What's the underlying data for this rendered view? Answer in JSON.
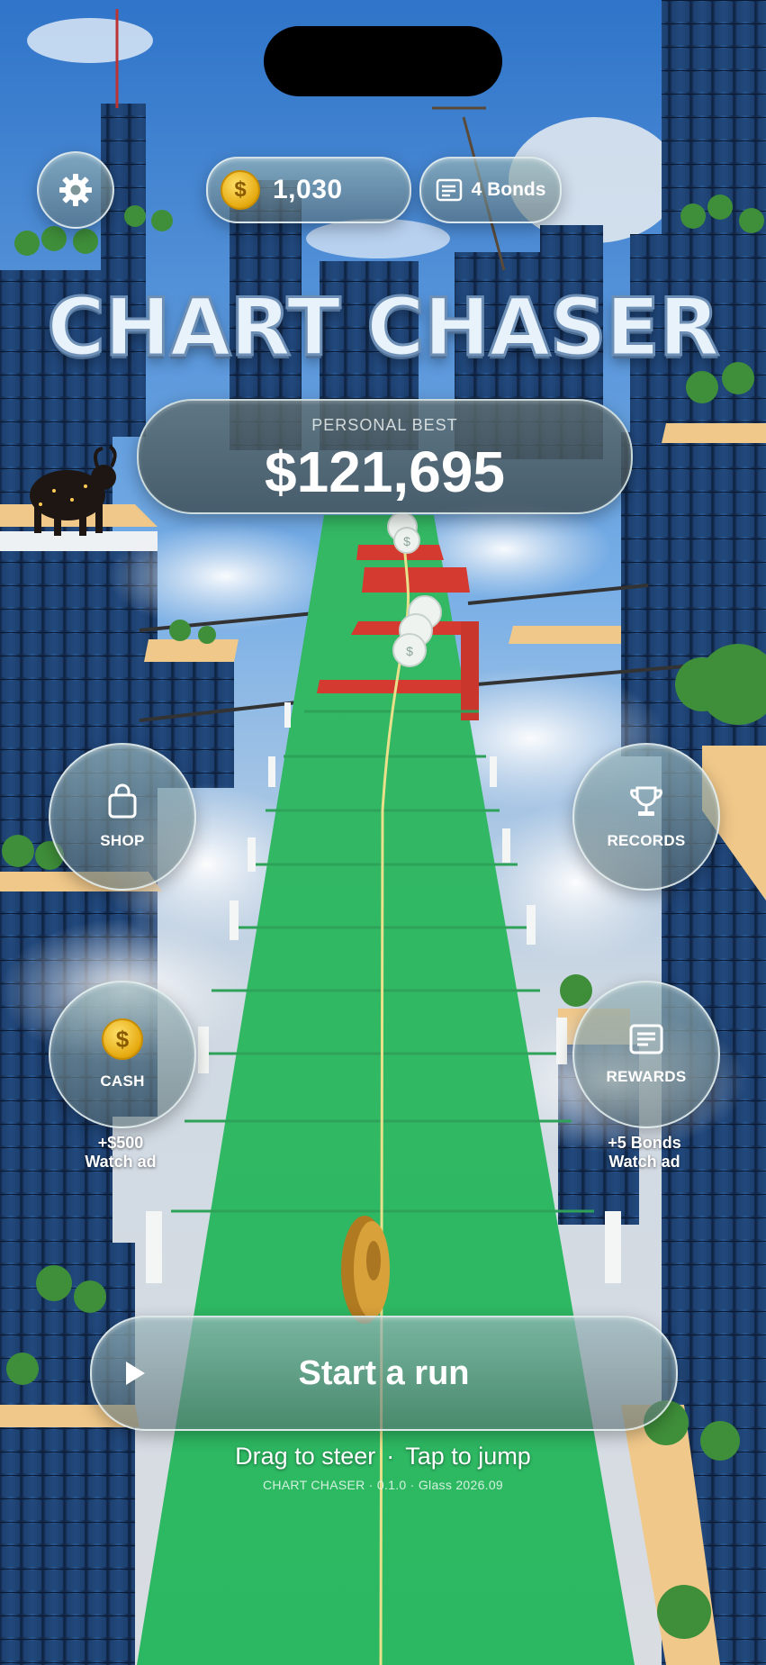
{
  "header": {
    "coins": "1,030",
    "bonds": "4 Bonds"
  },
  "game_title": "CHART CHASER",
  "personal_best": {
    "label": "PERSONAL BEST",
    "value": "$121,695"
  },
  "menu": {
    "shop_label": "SHOP",
    "records_label": "RECORDS",
    "cash_label": "CASH",
    "cash_note_line1": "+$500",
    "cash_note_line2": "Watch ad",
    "rewards_label": "REWARDS",
    "rewards_note_line1": "+5 Bonds",
    "rewards_note_line2": "Watch ad"
  },
  "start_button_label": "Start a run",
  "hints": {
    "steer": "Drag to steer",
    "separator": "·",
    "jump": "Tap to jump"
  },
  "footer": "CHART CHASER · 0.1.0 · Glass 2026.09",
  "colors": {
    "sky": "#3f86d8",
    "track_green": "#3fbf6e",
    "track_red": "#d23a2e",
    "coin_gold": "#f2c02a",
    "building_blue": "#1c3d6b",
    "platform_sand": "#e9c27e"
  }
}
